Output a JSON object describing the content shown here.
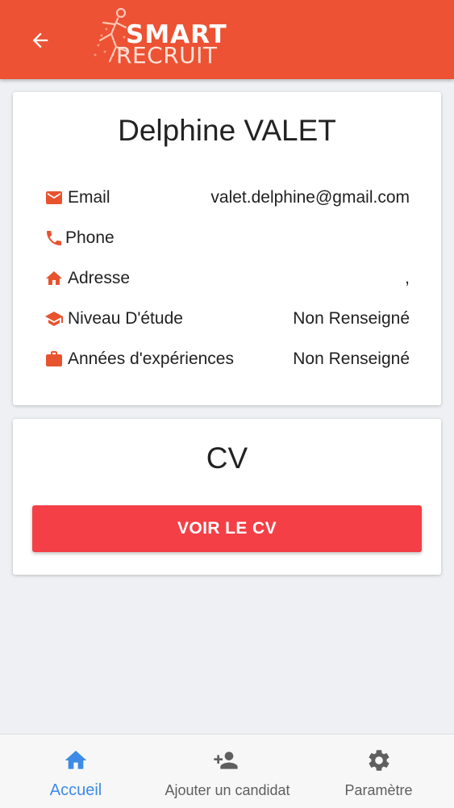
{
  "header": {
    "back_icon": "arrow-left-icon",
    "logo_top": "SMART",
    "logo_bottom": "RECRUIT",
    "brand_color": "#ec5233"
  },
  "profile": {
    "name": "Delphine VALET",
    "rows": [
      {
        "icon": "email-icon",
        "label": "Email",
        "value": "valet.delphine@gmail.com"
      },
      {
        "icon": "phone-icon",
        "label": "Phone",
        "value": ""
      },
      {
        "icon": "home-icon",
        "label": "Adresse",
        "value": ","
      },
      {
        "icon": "graduation-cap-icon",
        "label": "Niveau D'étude",
        "value": "Non Renseigné"
      },
      {
        "icon": "briefcase-icon",
        "label": "Années d'expériences",
        "value": "Non Renseigné"
      }
    ],
    "icon_color": "#e8532f"
  },
  "cv": {
    "title": "CV",
    "button_label": "VOIR LE CV",
    "button_color": "#f43f46"
  },
  "bottom_nav": {
    "items": [
      {
        "icon": "home-icon",
        "label": "Accueil",
        "active": true
      },
      {
        "icon": "add-person-icon",
        "label": "Ajouter un candidat",
        "active": false
      },
      {
        "icon": "gear-icon",
        "label": "Paramètre",
        "active": false
      }
    ],
    "active_color": "#3d8be6",
    "inactive_color": "#5f5f5f"
  }
}
